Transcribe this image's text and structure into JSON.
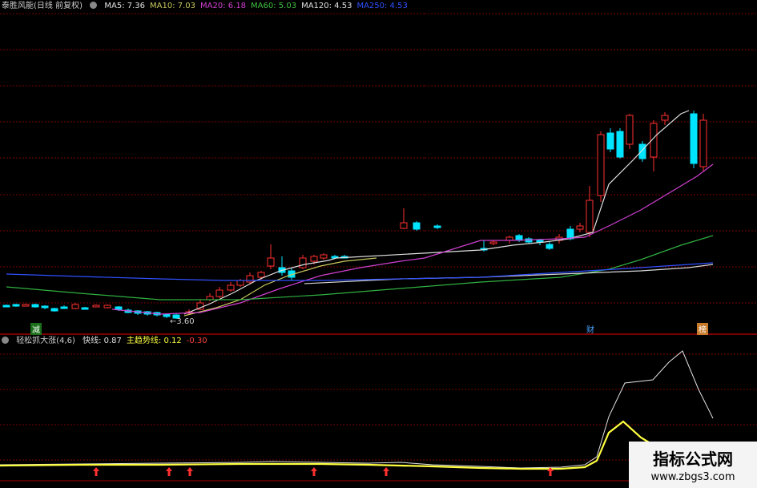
{
  "main_header": {
    "title": "泰胜风能(日线 前复权)",
    "items": [
      {
        "label": "MA5: 7.36",
        "color": "#e0e0e0"
      },
      {
        "label": "MA10: 7.03",
        "color": "#c8c860"
      },
      {
        "label": "MA20: 6.18",
        "color": "#d040d0"
      },
      {
        "label": "MA60: 5.03",
        "color": "#40c040"
      },
      {
        "label": "MA120: 4.53",
        "color": "#e0e0e0"
      },
      {
        "label": "MA250: 4.53",
        "color": "#3050ff"
      }
    ]
  },
  "sub_header": {
    "title": "轻松抓大涨(4,6)",
    "items": [
      {
        "label": "快线: 0.87",
        "color": "#e0e0e0"
      },
      {
        "label": "主趋势线: 0.12",
        "color": "#ffff40"
      },
      {
        "label": "-0.30",
        "color": "#ff4040"
      }
    ]
  },
  "annotations": {
    "low_price": "3.60",
    "tag_left": "减",
    "tag_mid": "财",
    "tag_right": "榜"
  },
  "watermark": {
    "title": "指标公式网",
    "url": "www.zbgs3.com"
  },
  "colors": {
    "up": "#ff3030",
    "down": "#00e5ff",
    "grid": "#7a0000",
    "separator": "#a00000"
  }
}
